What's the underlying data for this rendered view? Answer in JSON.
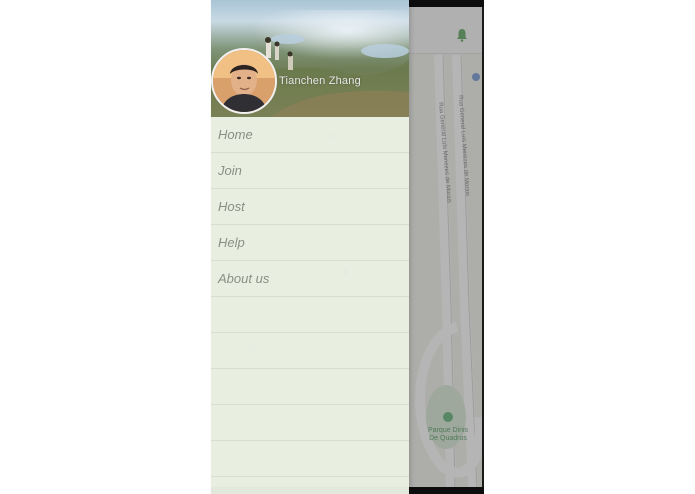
{
  "user": {
    "name": "Tianchen  Zhang"
  },
  "menu": {
    "items": [
      {
        "label": "Home"
      },
      {
        "label": "Join"
      },
      {
        "label": "Host"
      },
      {
        "label": "Help"
      },
      {
        "label": "About us"
      }
    ]
  },
  "map": {
    "park_label": "Parque Dinis De Quadros",
    "road_label_1": "Rua General Luís Menezes de Morais",
    "road_label_2": "Rua General Luís Menezes de Morais",
    "bell_icon": "bell-icon"
  },
  "colors": {
    "drawer_bg": "#e9f0e2",
    "menu_text": "#8a8f86",
    "bell": "#2e8b2e"
  }
}
